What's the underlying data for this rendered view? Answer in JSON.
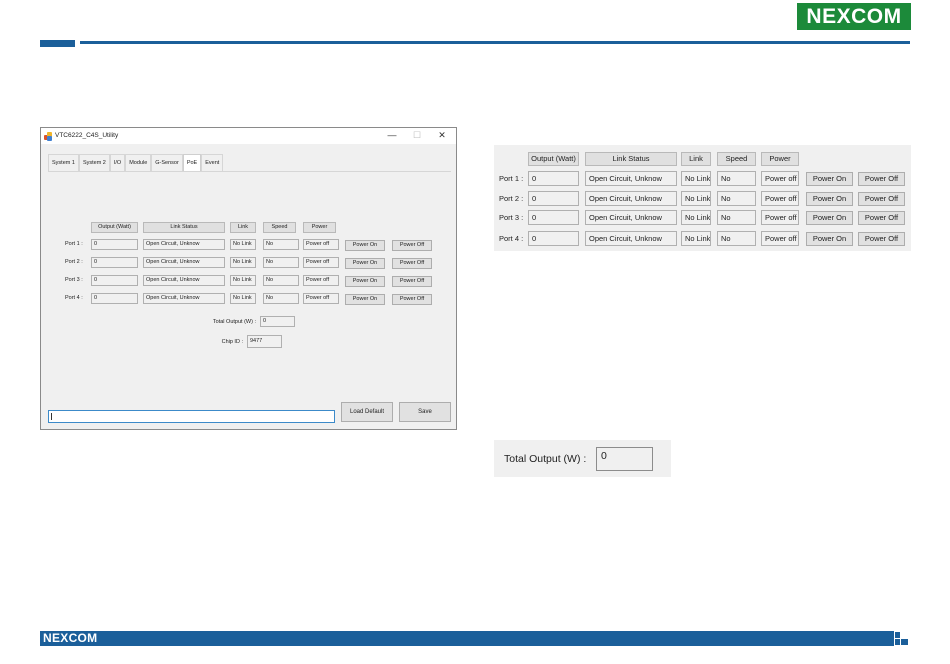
{
  "brand": {
    "logo_text": "NEXCOM",
    "footer_logo_text": "NEXCOM",
    "color": "#1b5f9a",
    "logo_color": "#1c8a3a"
  },
  "window": {
    "title": "VTC6222_C4S_Utility",
    "controls": {
      "minimize": "—",
      "maximize": "☐",
      "close": "✕"
    },
    "tabs": [
      "System 1",
      "System 2",
      "I/O",
      "Module",
      "G-Sensor",
      "PoE",
      "Event"
    ],
    "active_tab": "PoE",
    "headers": {
      "output": "Output (Watt)",
      "link_status": "Link Status",
      "link": "Link",
      "speed": "Speed",
      "power": "Power"
    },
    "ports": [
      {
        "label": "Port 1 :",
        "output": "0",
        "link_status": "Open Circuit, Unknow",
        "link": "No Link",
        "speed": "No",
        "power": "Power off",
        "on_label": "Power On",
        "off_label": "Power Off"
      },
      {
        "label": "Port 2 :",
        "output": "0",
        "link_status": "Open Circuit, Unknow",
        "link": "No Link",
        "speed": "No",
        "power": "Power off",
        "on_label": "Power On",
        "off_label": "Power Off"
      },
      {
        "label": "Port 3 :",
        "output": "0",
        "link_status": "Open Circuit, Unknow",
        "link": "No Link",
        "speed": "No",
        "power": "Power off",
        "on_label": "Power On",
        "off_label": "Power Off"
      },
      {
        "label": "Port 4 :",
        "output": "0",
        "link_status": "Open Circuit, Unknow",
        "link": "No Link",
        "speed": "No",
        "power": "Power off",
        "on_label": "Power On",
        "off_label": "Power Off"
      }
    ],
    "total_output_label": "Total Output (W) :",
    "total_output_value": "0",
    "chip_id_label": "Chip ID :",
    "chip_id_value": "9477",
    "status_text": "",
    "load_default_label": "Load Default",
    "save_label": "Save"
  },
  "zoom": {
    "headers": {
      "output": "Output (Watt)",
      "link_status": "Link Status",
      "link": "Link",
      "speed": "Speed",
      "power": "Power"
    },
    "ports": [
      {
        "label": "Port 1 :",
        "output": "0",
        "link_status": "Open Circuit, Unknow",
        "link": "No Link",
        "speed": "No",
        "power": "Power off",
        "on_label": "Power On",
        "off_label": "Power Off"
      },
      {
        "label": "Port 2 :",
        "output": "0",
        "link_status": "Open Circuit, Unknow",
        "link": "No Link",
        "speed": "No",
        "power": "Power off",
        "on_label": "Power On",
        "off_label": "Power Off"
      },
      {
        "label": "Port 3 :",
        "output": "0",
        "link_status": "Open Circuit, Unknow",
        "link": "No Link",
        "speed": "No",
        "power": "Power off",
        "on_label": "Power On",
        "off_label": "Power Off"
      },
      {
        "label": "Port 4 :",
        "output": "0",
        "link_status": "Open Circuit, Unknow",
        "link": "No Link",
        "speed": "No",
        "power": "Power off",
        "on_label": "Power On",
        "off_label": "Power Off"
      }
    ],
    "total_output_label": "Total Output (W) :",
    "total_output_value": "0"
  }
}
